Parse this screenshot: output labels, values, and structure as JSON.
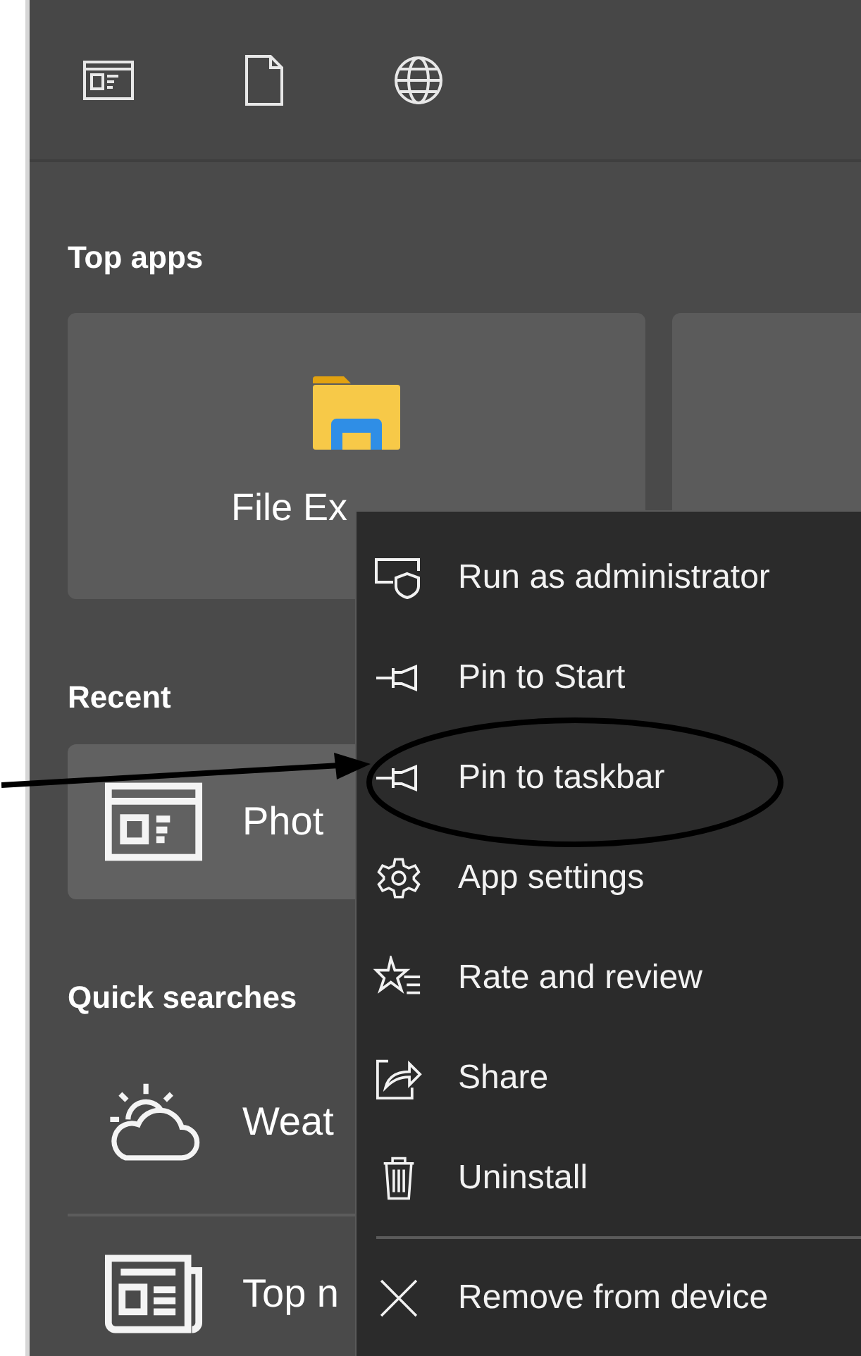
{
  "sections": [
    {
      "kind": "tiles",
      "heading": "Top apps",
      "items": [
        {
          "kind": "folder",
          "label": "File Ex"
        },
        {
          "kind": "blank"
        }
      ]
    },
    {
      "kind": "list",
      "heading": "Recent",
      "items": [
        {
          "kind": "app",
          "label": "Phot",
          "selected": true
        }
      ]
    },
    {
      "kind": "list",
      "heading": "Quick searches",
      "items": [
        {
          "kind": "weather",
          "label": "Weat",
          "selected": false
        },
        {
          "kind": "news",
          "label": "Top n",
          "selected": false
        }
      ]
    }
  ],
  "context_menu": {
    "items": [
      {
        "kind": "admin",
        "label": "Run as administrator",
        "circled": false
      },
      {
        "kind": "pin",
        "label": "Pin to Start",
        "circled": false
      },
      {
        "kind": "pin",
        "label": "Pin to taskbar",
        "circled": true
      },
      {
        "kind": "gear",
        "label": "App settings",
        "circled": false
      },
      {
        "kind": "rate",
        "label": "Rate and review",
        "circled": false
      },
      {
        "kind": "share",
        "label": "Share",
        "circled": false
      },
      {
        "kind": "trash",
        "label": "Uninstall",
        "circled": false
      },
      {
        "kind": "separator"
      },
      {
        "kind": "remove",
        "label": "Remove from device",
        "circled": false
      }
    ]
  }
}
